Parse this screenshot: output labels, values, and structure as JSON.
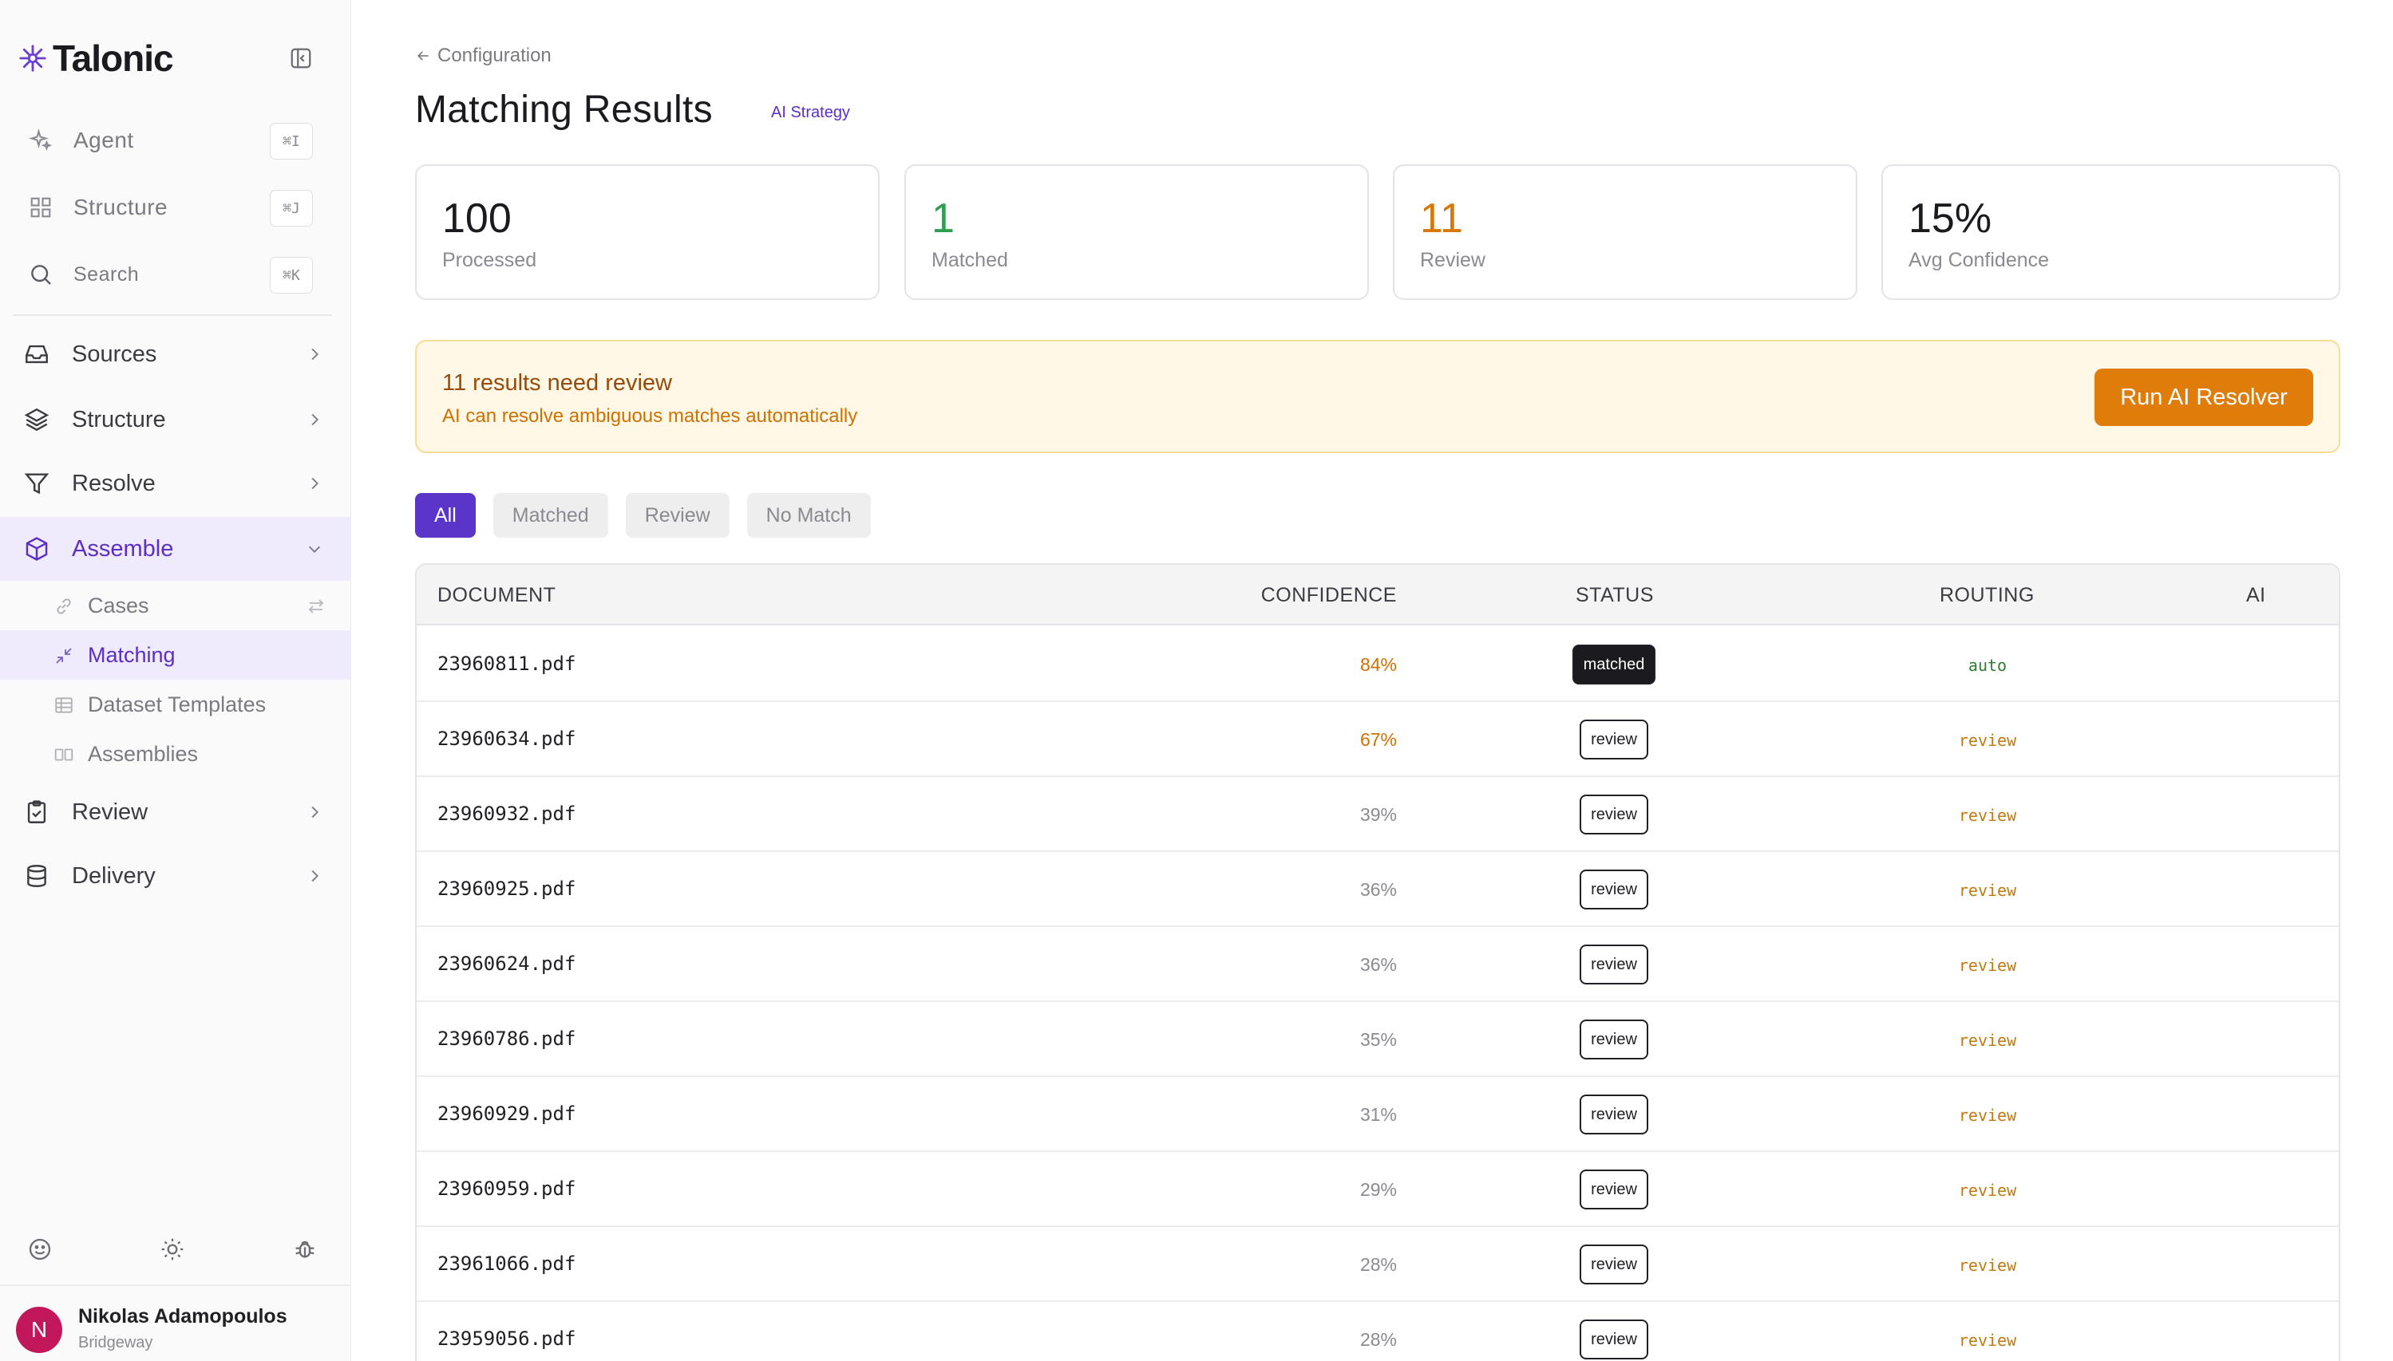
{
  "app": {
    "brand": "Talonic"
  },
  "sidebar": {
    "quick": [
      {
        "label": "Agent",
        "shortcut": "⌘I",
        "icon": "sparkle-icon"
      },
      {
        "label": "Structure",
        "shortcut": "⌘J",
        "icon": "grid-icon"
      },
      {
        "label": "Search",
        "shortcut": "⌘K",
        "icon": "search-icon"
      }
    ],
    "nav": [
      {
        "label": "Sources",
        "icon": "inbox-icon"
      },
      {
        "label": "Structure",
        "icon": "layers-icon"
      },
      {
        "label": "Resolve",
        "icon": "filter-icon"
      },
      {
        "label": "Assemble",
        "icon": "cube-icon",
        "expanded": true
      },
      {
        "label": "Review",
        "icon": "clipboard-check-icon"
      },
      {
        "label": "Delivery",
        "icon": "database-icon"
      }
    ],
    "assemble_children": [
      {
        "label": "Cases",
        "icon": "link-icon"
      },
      {
        "label": "Matching",
        "icon": "arrows-in-icon",
        "active": true
      },
      {
        "label": "Dataset Templates",
        "icon": "table-icon"
      },
      {
        "label": "Assemblies",
        "icon": "columns-icon"
      }
    ],
    "user": {
      "initial": "N",
      "name": "Nikolas Adamopoulos",
      "org": "Bridgeway"
    }
  },
  "header": {
    "back_label": "Configuration",
    "title": "Matching Results",
    "strategy": "AI Strategy"
  },
  "stats": [
    {
      "value": "100",
      "caption": "Processed",
      "color": "#1a1a1f"
    },
    {
      "value": "1",
      "caption": "Matched",
      "color": "#2e9e4f"
    },
    {
      "value": "11",
      "caption": "Review",
      "color": "#d97706"
    },
    {
      "value": "15%",
      "caption": "Avg Confidence",
      "color": "#1a1a1f"
    }
  ],
  "alert": {
    "title": "11 results need review",
    "subtitle": "AI can resolve ambiguous matches automatically",
    "button": "Run AI Resolver"
  },
  "filters": [
    "All",
    "Matched",
    "Review",
    "No Match"
  ],
  "table": {
    "columns": [
      "DOCUMENT",
      "CONFIDENCE",
      "STATUS",
      "ROUTING",
      "AI"
    ],
    "rows": [
      {
        "document": "23960811.pdf",
        "confidence": "84%",
        "status": "matched",
        "routing": "auto"
      },
      {
        "document": "23960634.pdf",
        "confidence": "67%",
        "status": "review",
        "routing": "review"
      },
      {
        "document": "23960932.pdf",
        "confidence": "39%",
        "status": "review",
        "routing": "review"
      },
      {
        "document": "23960925.pdf",
        "confidence": "36%",
        "status": "review",
        "routing": "review"
      },
      {
        "document": "23960624.pdf",
        "confidence": "36%",
        "status": "review",
        "routing": "review"
      },
      {
        "document": "23960786.pdf",
        "confidence": "35%",
        "status": "review",
        "routing": "review"
      },
      {
        "document": "23960929.pdf",
        "confidence": "31%",
        "status": "review",
        "routing": "review"
      },
      {
        "document": "23960959.pdf",
        "confidence": "29%",
        "status": "review",
        "routing": "review"
      },
      {
        "document": "23961066.pdf",
        "confidence": "28%",
        "status": "review",
        "routing": "review"
      },
      {
        "document": "23959056.pdf",
        "confidence": "28%",
        "status": "review",
        "routing": "review"
      }
    ]
  },
  "colors": {
    "accent": "#5b35c9",
    "warning": "#e07c0a",
    "success": "#2e9e4f"
  }
}
